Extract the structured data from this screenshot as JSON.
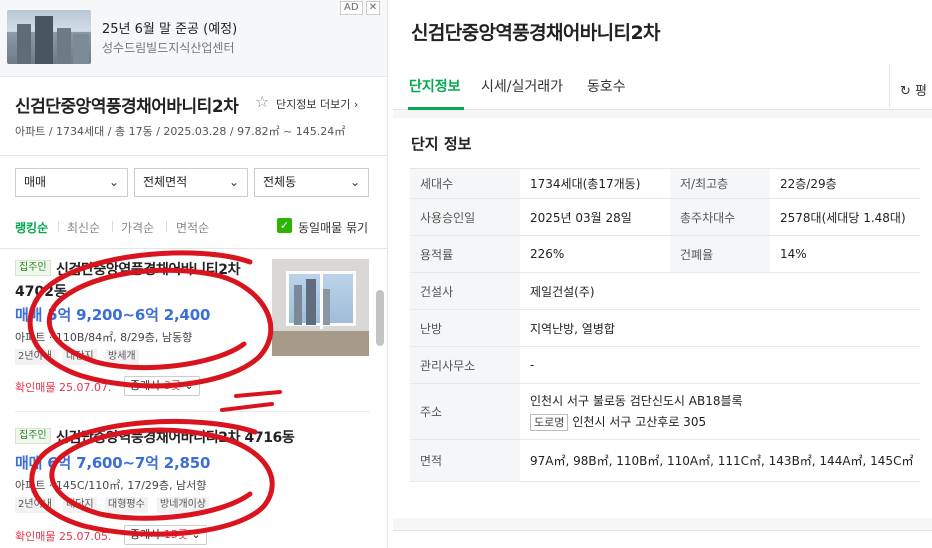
{
  "ad": {
    "title": "25년 6월 말 준공 (예정)",
    "subtitle": "성수드림빌드지식산업센터",
    "badge": "AD",
    "close": "✕"
  },
  "complex": {
    "name": "신검단중앙역풍경채어바니티2차",
    "more_link": "단지정보 더보기 ›",
    "info": "아파트 / 1734세대 / 총 17동 / 2025.03.28 / 97.82㎡ ~ 145.24㎡"
  },
  "filters": {
    "trade": "매매",
    "area": "전체면적",
    "dong": "전체동"
  },
  "sort": {
    "options": [
      "랭킹순",
      "최신순",
      "가격순",
      "면적순"
    ],
    "active": "랭킹순",
    "same_listing_label": "동일매물 묶기"
  },
  "listings": [
    {
      "tag": "집주인",
      "title": "신검단중앙역풍경채어바니티2차",
      "dong": "4702동",
      "price": "매매 5억 9,200~6억 2,400",
      "spec": "아파트 · 110B/84㎡, 8/29층, 남동향",
      "chips": [
        "2년이내",
        "대단지",
        "방세개"
      ],
      "confirm": "확인매물 25.07.07.",
      "agent_prefix": "중개사 ",
      "agent_count": "3곳"
    },
    {
      "tag": "집주인",
      "title": "신검단중앙역풍경채어바니티2차 4716동",
      "price": "매매 6억 7,600~7억 2,850",
      "spec": "아파트 · 145C/110㎡, 17/29층, 남서향",
      "chips": [
        "2년이내",
        "대단지",
        "대형평수",
        "방네개이상"
      ],
      "confirm": "확인매물 25.07.05.",
      "agent_prefix": "중개사 ",
      "agent_count": "15곳"
    }
  ],
  "detail": {
    "title": "신검단중앙역풍경채어바니티2차",
    "tabs": [
      "단지정보",
      "시세/실거래가",
      "동호수"
    ],
    "active_tab": "단지정보",
    "action_label": "↻ 평",
    "section_title": "단지 정보",
    "rows": {
      "households_label": "세대수",
      "households": "1734세대(총17개동)",
      "floors_label": "저/최고층",
      "floors": "22층/29층",
      "approval_label": "사용승인일",
      "approval": "2025년 03월 28일",
      "parking_label": "총주차대수",
      "parking": "2578대(세대당 1.48대)",
      "far_label": "용적률",
      "far": "226%",
      "bcr_label": "건폐율",
      "bcr": "14%",
      "builder_label": "건설사",
      "builder": "제일건설(주)",
      "heating_label": "난방",
      "heating": "지역난방, 열병합",
      "office_label": "관리사무소",
      "office": "-",
      "address_label": "주소",
      "address": "인천시 서구 불로동 검단신도시 AB18블록",
      "road_tag": "도로명",
      "road_address": "인천시 서구 고산후로 305",
      "area_label": "면적",
      "areas": "97A㎡, 98B㎡, 110B㎡, 110A㎡, 111C㎡, 143B㎡, 144A㎡, 145C㎡"
    }
  },
  "colors": {
    "accent_green": "#03a94d",
    "price_blue": "#3b6ed6",
    "confirm_red": "#e7344a",
    "scribble_red": "#d9141e"
  }
}
